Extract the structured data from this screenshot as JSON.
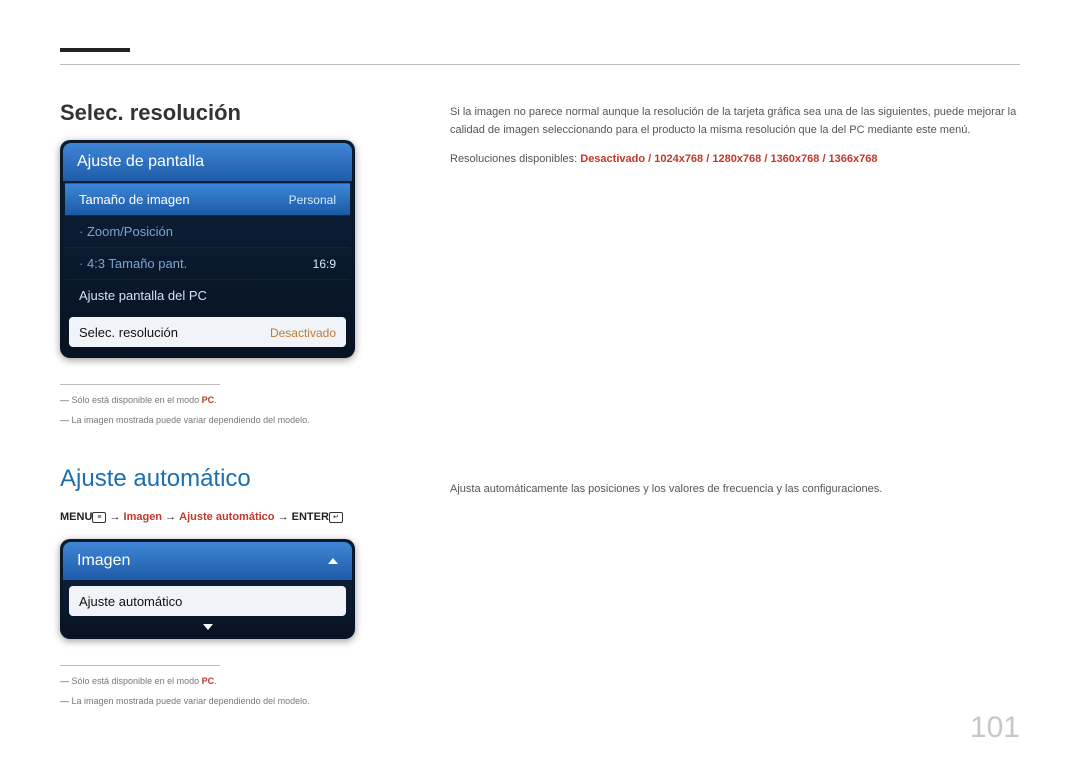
{
  "section1": {
    "title": "Selec. resolución",
    "panel_header": "Ajuste de pantalla",
    "rows": [
      {
        "label": "Tamaño de imagen",
        "value": "Personal"
      },
      {
        "label": "Zoom/Posición",
        "value": ""
      },
      {
        "label": "4:3 Tamaño pant.",
        "value": "16:9"
      },
      {
        "label": "Ajuste pantalla del PC",
        "value": ""
      },
      {
        "label": "Selec. resolución",
        "value": "Desactivado"
      }
    ],
    "right_text": "Si la imagen no parece normal aunque la resolución de la tarjeta gráfica sea una de las siguientes, puede mejorar la calidad de imagen seleccionando para el producto la misma resolución que la del PC mediante este menú.",
    "res_label": "Resoluciones disponibles:",
    "res_values": "Desactivado / 1024x768 / 1280x768 / 1360x768 / 1366x768",
    "footnote1_pre": "Sólo está disponible en el modo ",
    "footnote1_pc": "PC",
    "footnote1_post": ".",
    "footnote2": "La imagen mostrada puede variar dependiendo del modelo."
  },
  "section2": {
    "title": "Ajuste automático",
    "breadcrumb_menu": "MENU",
    "breadcrumb_arrow": " → ",
    "breadcrumb_imagen": "Imagen",
    "breadcrumb_ajuste": "Ajuste automático",
    "breadcrumb_enter": "ENTER",
    "panel_header": "Imagen",
    "selected_label": "Ajuste automático",
    "right_text": "Ajusta automáticamente las posiciones y los valores de frecuencia y las configuraciones.",
    "footnote1_pre": "Sólo está disponible en el modo ",
    "footnote1_pc": "PC",
    "footnote1_post": ".",
    "footnote2": "La imagen mostrada puede variar dependiendo del modelo."
  },
  "page_number": "101"
}
